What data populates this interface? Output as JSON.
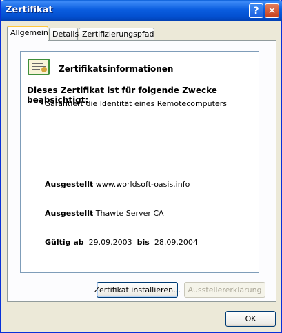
{
  "window": {
    "title": "Zertifikat"
  },
  "titlebar": {
    "help_glyph": "?",
    "close_glyph": "✕"
  },
  "tabs": [
    {
      "label": "Allgemein",
      "active": true
    },
    {
      "label": "Details",
      "active": false
    },
    {
      "label": "Zertifizierungspfad",
      "active": false
    }
  ],
  "info": {
    "heading": "Zertifikatsinformationen",
    "purpose_title": "Dieses Zertifikat ist für folgende Zwecke beabsichtigt:",
    "purposes": [
      "•Garantiert die Identität eines Remotecomputers"
    ],
    "issued_to_label": "Ausgestellt",
    "issued_to_value": "www.worldsoft-oasis.info",
    "issued_by_label": "Ausgestellt",
    "issued_by_value": "Thawte Server CA",
    "valid_from_label": "Gültig ab",
    "valid_from_value": "29.09.2003",
    "valid_to_label": "bis",
    "valid_to_value": "28.09.2004"
  },
  "buttons": {
    "install": "Zertifikat installieren...",
    "issuer_statement": "Ausstellererklärung",
    "ok": "OK"
  },
  "icons": {
    "certificate": "certificate-icon"
  },
  "colors": {
    "titlebar": "#0b5ee0",
    "accent_tab": "#ffc73c",
    "background": "#ece9d8"
  }
}
